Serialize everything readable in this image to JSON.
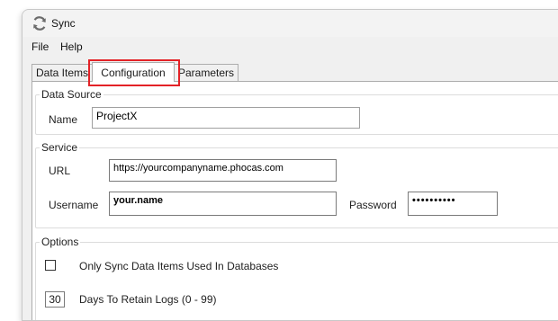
{
  "window": {
    "title": "Sync"
  },
  "menu": {
    "file": "File",
    "help": "Help"
  },
  "tabs": [
    {
      "label": "Data Items"
    },
    {
      "label": "Configuration"
    },
    {
      "label": "Parameters"
    }
  ],
  "active_tab": "Configuration",
  "data_source": {
    "group_label": "Data Source",
    "name_label": "Name",
    "name_value": "ProjectX"
  },
  "service": {
    "group_label": "Service",
    "url_label": "URL",
    "url_value": "https://yourcompanyname.phocas.com",
    "username_label": "Username",
    "username_value": "your.name",
    "password_label": "Password",
    "password_value": "••••••••••"
  },
  "options": {
    "group_label": "Options",
    "only_sync_label": "Only Sync Data Items Used In Databases",
    "only_sync_checked": false,
    "retain_value": "30",
    "retain_label": "Days To Retain Logs (0 - 99)"
  },
  "colors": {
    "highlight": "#e32227"
  }
}
